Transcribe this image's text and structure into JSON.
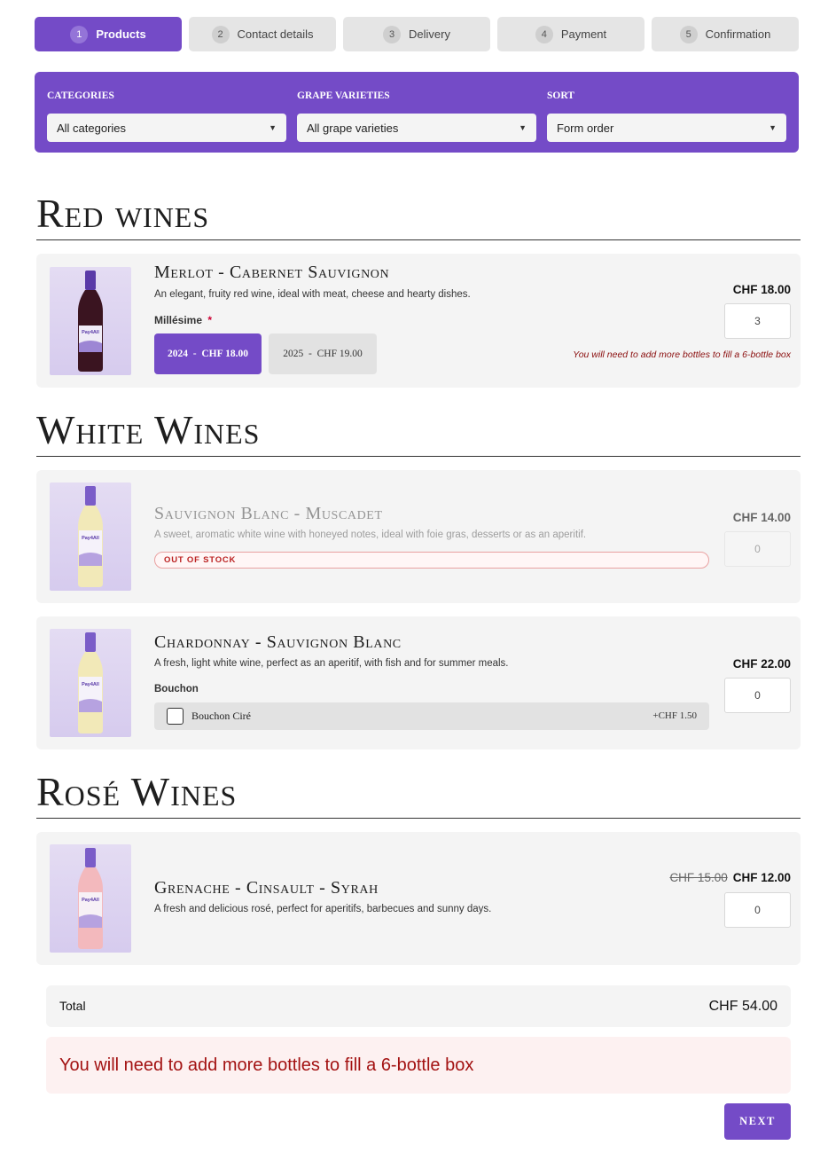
{
  "steps": [
    {
      "num": "1",
      "label": "Products"
    },
    {
      "num": "2",
      "label": "Contact details"
    },
    {
      "num": "3",
      "label": "Delivery"
    },
    {
      "num": "4",
      "label": "Payment"
    },
    {
      "num": "5",
      "label": "Confirmation"
    }
  ],
  "filters": {
    "categories_label": "CATEGORIES",
    "categories_value": "All categories",
    "grapes_label": "GRAPE VARIETIES",
    "grapes_value": "All grape varieties",
    "sort_label": "SORT",
    "sort_value": "Form order"
  },
  "sections": {
    "red": "Red wines",
    "white": "White Wines",
    "rose": "Rosé Wines"
  },
  "products": {
    "merlot": {
      "name": "Merlot - Cabernet Sauvignon",
      "desc": "An elegant, fruity red wine, ideal with meat, cheese and hearty dishes.",
      "option_label": "Millésime",
      "required_mark": "*",
      "options": [
        "2024  -  CHF 18.00",
        "2025  -  CHF 19.00"
      ],
      "price": "CHF 18.00",
      "qty": "3",
      "warning": "You will need to add more bottles to fill a 6-bottle box"
    },
    "sauvignon": {
      "name": "Sauvignon Blanc - Muscadet",
      "desc": "A sweet, aromatic white wine with honeyed notes, ideal with foie gras, desserts or as an aperitif.",
      "badge": "OUT OF STOCK",
      "price": "CHF 14.00",
      "qty": "0"
    },
    "chardonnay": {
      "name": "Chardonnay - Sauvignon Blanc",
      "desc": "A fresh, light white wine, perfect as an aperitif, with fish and for summer meals.",
      "option_label": "Bouchon",
      "checkbox_label": "Bouchon Ciré",
      "checkbox_price": "+CHF 1.50",
      "price": "CHF 22.00",
      "qty": "0"
    },
    "grenache": {
      "name": "Grenache - Cinsault - Syrah",
      "desc": "A fresh and delicious rosé, perfect for aperitifs, barbecues and sunny days.",
      "old_price": "CHF 15.00",
      "price": "CHF 12.00",
      "qty": "0"
    }
  },
  "bottle_brand": "Pay4All",
  "total": {
    "label": "Total",
    "value": "CHF 54.00"
  },
  "alert": "You will need to add more bottles to fill a 6-bottle box",
  "next_label": "NEXT",
  "colors": {
    "accent": "#744bc7",
    "red_wine": "#3a1420",
    "white_wine": "#f2e9b8",
    "rose_wine": "#f3b9bd",
    "error": "#a31212"
  }
}
